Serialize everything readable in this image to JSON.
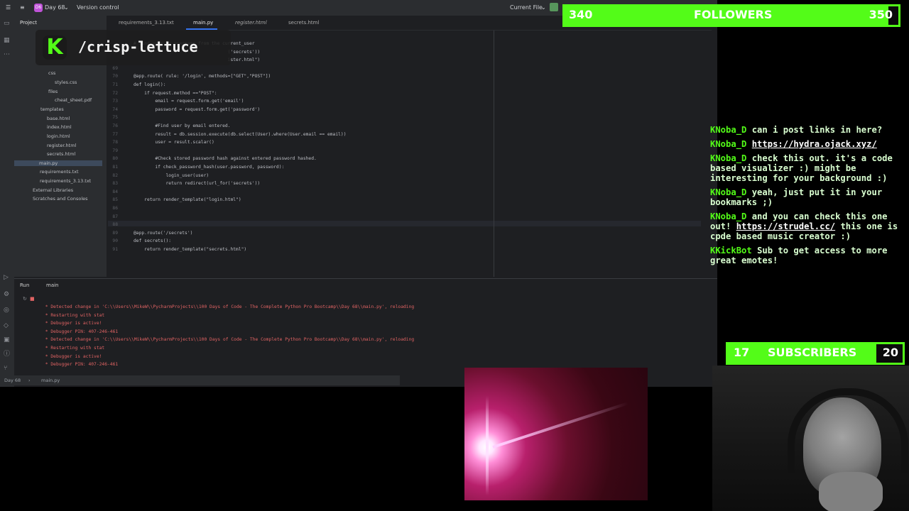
{
  "titlebar": {
    "project_badge": "D6",
    "project_name": "Day 68",
    "vcs": "Version control",
    "run_config": "Current File"
  },
  "tabs": [
    {
      "label": "requirements_3.13.txt"
    },
    {
      "label": "main.py"
    },
    {
      "label": "register.html"
    },
    {
      "label": "secrets.html"
    }
  ],
  "project_panel": {
    "title": "Project",
    "items": [
      {
        "label": "css"
      },
      {
        "label": "styles.css"
      },
      {
        "label": "files"
      },
      {
        "label": "cheat_sheet.pdf"
      },
      {
        "label": "templates"
      },
      {
        "label": "base.html"
      },
      {
        "label": "index.html"
      },
      {
        "label": "login.html"
      },
      {
        "label": "register.html"
      },
      {
        "label": "secrets.html"
      },
      {
        "label": "main.py"
      },
      {
        "label": "requirements.txt"
      },
      {
        "label": "requirements_3.13.txt"
      },
      {
        "label": "External Libraries"
      },
      {
        "label": "Scratches and Consoles"
      }
    ]
  },
  "editor": {
    "lines": [
      {
        "n": "",
        "code": "# Find user by username from the current_user"
      },
      {
        "n": "",
        "code": "                                   ('secrets'))"
      },
      {
        "n": "",
        "code": "                                   ister.html\")"
      },
      {
        "n": "69",
        "code": ""
      },
      {
        "n": "70",
        "code": "@app.route( rule: '/login', methods=[\"GET\",\"POST\"])"
      },
      {
        "n": "71",
        "code": "def login():"
      },
      {
        "n": "72",
        "code": "    if request.method ==\"POST\":"
      },
      {
        "n": "73",
        "code": "        email = request.form.get('email')"
      },
      {
        "n": "74",
        "code": "        password = request.form.get('password')"
      },
      {
        "n": "75",
        "code": ""
      },
      {
        "n": "76",
        "code": "        #Find user by email entered."
      },
      {
        "n": "77",
        "code": "        result = db.session.execute(db.select(User).where(User.email == email))"
      },
      {
        "n": "78",
        "code": "        user = result.scalar()"
      },
      {
        "n": "79",
        "code": ""
      },
      {
        "n": "80",
        "code": "        #Check stored password hash against entered password hashed."
      },
      {
        "n": "81",
        "code": "        if check_password_hash(user.password, password):"
      },
      {
        "n": "82",
        "code": "            login_user(user)"
      },
      {
        "n": "83",
        "code": "            return redirect(url_for('secrets'))"
      },
      {
        "n": "84",
        "code": ""
      },
      {
        "n": "85",
        "code": "    return render_template(\"login.html\")"
      },
      {
        "n": "86",
        "code": ""
      },
      {
        "n": "87",
        "code": ""
      },
      {
        "n": "88",
        "code": ""
      },
      {
        "n": "89",
        "code": "@app.route('/secrets')"
      },
      {
        "n": "90",
        "code": "def secrets():"
      },
      {
        "n": "91",
        "code": "    return render_template(\"secrets.html\")"
      }
    ]
  },
  "run_panel": {
    "tab_run": "Run",
    "tab_main": "main",
    "output": [
      " * Detected change in 'C:\\\\Users\\\\MikeW\\\\PycharmProjects\\\\100 Days of Code - The Complete Python Pro Bootcamp\\\\Day 68\\\\main.py', reloading",
      " * Restarting with stat",
      " * Debugger is active!",
      " * Debugger PIN: 407-246-461",
      " * Detected change in 'C:\\\\Users\\\\MikeW\\\\PycharmProjects\\\\100 Days of Code - The Complete Python Pro Bootcamp\\\\Day 68\\\\main.py', reloading",
      " * Restarting with stat",
      " * Debugger is active!",
      " * Debugger PIN: 407-246-461"
    ]
  },
  "statusbar": {
    "project": "Day 68",
    "file": "main.py"
  },
  "stream": {
    "handle": "/crisp-lettuce",
    "followers_goal": {
      "current": "340",
      "label": "FOLLOWERS",
      "target": "350",
      "progress": 0.971
    },
    "subscribers_goal": {
      "current": "17",
      "label": "SUBSCRIBERS",
      "target": "20",
      "progress": 0.85
    },
    "chat": [
      {
        "user": "Noba_D",
        "text": "can i post links in here?",
        "link": ""
      },
      {
        "user": "Noba_D",
        "text": "",
        "link": "https://hydra.ojack.xyz/"
      },
      {
        "user": "Noba_D",
        "text": "check this out. it's a code based visualizer :) might be interesting for your background :)",
        "link": ""
      },
      {
        "user": "Noba_D",
        "text": "yeah, just put it in your bookmarks ;)",
        "link": ""
      },
      {
        "user": "Noba_D",
        "text": "and you can check this one out!",
        "link": "https://strudel.cc/",
        "after": "this one is cpde based music creator :)"
      },
      {
        "user": "KickBot",
        "text": "Sub to get access to more great emotes!",
        "link": ""
      }
    ]
  },
  "colors": {
    "kick_green": "#53fc18",
    "ide_bg": "#1e1f22",
    "panel_bg": "#2b2d30"
  }
}
